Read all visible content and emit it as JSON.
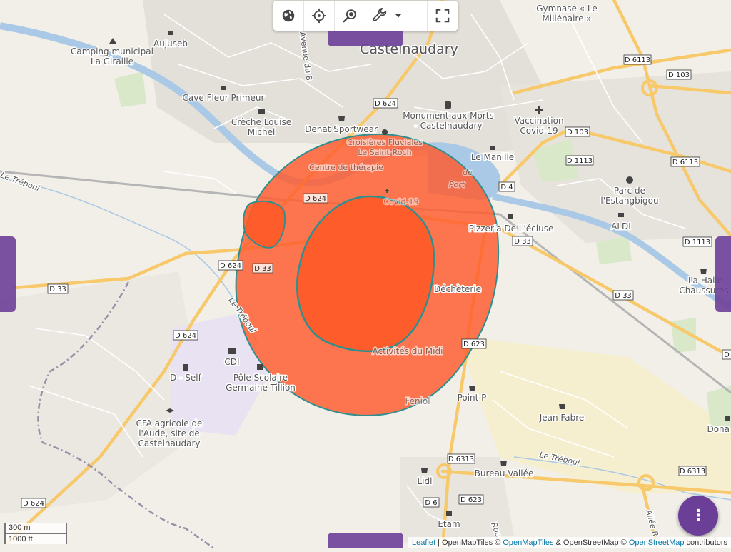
{
  "colors": {
    "accent": "#6b3f98",
    "zone_outer": "#ff5a2c",
    "zone_stroke": "#2f8f8f",
    "water": "#a9c9e6",
    "road_major": "#f7c96b",
    "residential": "#e0dcd6"
  },
  "toolbar": {
    "globe_icon": "globe-icon",
    "locate_icon": "crosshair-icon",
    "search_place_icon": "map-search-icon",
    "tools_icon": "wrench-icon",
    "dropdown_icon": "caret-down-icon",
    "fullscreen_icon": "fullscreen-icon"
  },
  "fab": {
    "label": "⋮"
  },
  "scale": {
    "metric": "300 m",
    "imperial": "1000 ft"
  },
  "attribution": {
    "leaflet": "Leaflet",
    "sep": " | OpenMapTiles © ",
    "openmaptiles": "OpenMapTiles",
    "mid": " & OpenStreetMap © ",
    "osm": "OpenStreetMap",
    "end": " contributors"
  },
  "places": {
    "town": "Castelnaudary",
    "camping1": "Camping municipal",
    "camping2": "La Giraille",
    "aujuseb": "Aujuseb",
    "cave": "Cave Fleur Primeur",
    "creche1": "Crèche Louise",
    "creche2": "Michel",
    "denat": "Denat Sportwear",
    "croisieres1": "Croisières Fluviales",
    "croisieres2": "Le Saint-Roch",
    "therapie": "Centre de thérapie",
    "covid_hidden": "Covid-19",
    "monument1": "Monument aux Morts",
    "monument2": "- Castelnaudary",
    "vacc1": "Vaccination",
    "vacc2": "Covid-19",
    "manille": "Le Manille",
    "gymnase1": "Gymnase « Le",
    "gymnase2": "Millénaire »",
    "avenue": "Avenue du 8",
    "parc1": "Parc de",
    "parc2": "l'Estangbigou",
    "aldi": "ALDI",
    "pizzeria": "Pizzeria De L'écluse",
    "halle1": "La Halle",
    "halle2": "Chaussures",
    "decheterie": "Déchèterie",
    "activites": "Activités du Midi",
    "fenol": "Feniol",
    "pointp": "Point P",
    "jean": "Jean Fabre",
    "dona": "Dona",
    "bureau": "Bureau Vallée",
    "lidl": "Lidl",
    "etam": "Etam",
    "cdi": "CDI",
    "dself": "D - Self",
    "pole1": "Pôle Scolaire",
    "pole2": "Germaine Tillion",
    "cfa1": "CFA agricole de",
    "cfa2": "l'Aude, site de",
    "cfa3": "Castelnaudary",
    "port1": "de",
    "port2": "Port",
    "treboul_w": "Le Tréboul",
    "treboul_s": "Le Tréboul",
    "treboul_e": "Le Tréboul",
    "allee": "Allée R",
    "rou": "Rou"
  },
  "roads": {
    "d624a": "D 624",
    "d624b": "D 624",
    "d624c": "D 624",
    "d624d": "D 624",
    "d624e": "D 624",
    "d33a": "D 33",
    "d33b": "D 33",
    "d33c": "D 33",
    "d33d": "D 33",
    "d6113": "D 6113",
    "d103a": "D 103",
    "d103b": "D 103",
    "d1113a": "D 1113",
    "d1113b": "D 1113",
    "d4": "D 4",
    "d6113b": "D 6113",
    "d623a": "D 623",
    "d623b": "D 623",
    "d6313a": "D 6313",
    "d6313b": "D 6313",
    "d6": "D 6",
    "dcut": "D"
  }
}
